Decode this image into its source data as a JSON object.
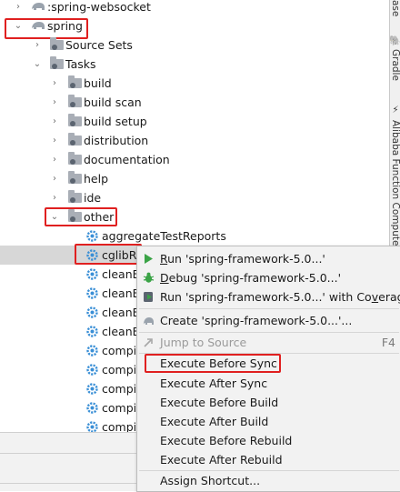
{
  "tree": {
    "rows": [
      {
        "id": "spring-websocket",
        "label": ":spring-websocket",
        "arrow": "›"
      },
      {
        "id": "spring",
        "label": "spring",
        "arrow": "⌄"
      },
      {
        "id": "source-sets",
        "label": "Source Sets",
        "arrow": "›"
      },
      {
        "id": "tasks",
        "label": "Tasks",
        "arrow": "⌄"
      },
      {
        "id": "build",
        "label": "build",
        "arrow": "›"
      },
      {
        "id": "build-scan",
        "label": "build scan",
        "arrow": "›"
      },
      {
        "id": "build-setup",
        "label": "build setup",
        "arrow": "›"
      },
      {
        "id": "distribution",
        "label": "distribution",
        "arrow": "›"
      },
      {
        "id": "documentation",
        "label": "documentation",
        "arrow": "›"
      },
      {
        "id": "help",
        "label": "help",
        "arrow": "›"
      },
      {
        "id": "ide",
        "label": "ide",
        "arrow": "›"
      },
      {
        "id": "other",
        "label": "other",
        "arrow": "⌄"
      },
      {
        "id": "aggregate-test-reports",
        "label": "aggregateTestReports"
      },
      {
        "id": "cglib",
        "label": "cglibRe"
      },
      {
        "id": "clean1",
        "label": "cleanE"
      },
      {
        "id": "clean2",
        "label": "cleanE"
      },
      {
        "id": "clean3",
        "label": "cleanE"
      },
      {
        "id": "clean4",
        "label": "cleanE"
      },
      {
        "id": "compile1",
        "label": "compil"
      },
      {
        "id": "compile2",
        "label": "compil"
      },
      {
        "id": "compile3",
        "label": "compil"
      },
      {
        "id": "compile4",
        "label": "compil"
      },
      {
        "id": "compile5",
        "label": "compil"
      }
    ]
  },
  "side_panel": {
    "top_text": "ase",
    "gradle": "Gradle",
    "alibaba": "Alibaba Function Compute"
  },
  "context_menu": {
    "run": {
      "mnemonic": "R",
      "rest": "un 'spring-framework-5.0...'"
    },
    "debug": {
      "mnemonic": "D",
      "rest": "ebug 'spring-framework-5.0...'"
    },
    "coverage": {
      "text": "Run 'spring-framework-5.0...' with Co",
      "mnemonic": "v",
      "rest": "erage"
    },
    "create": {
      "text": "Create 'spring-framework-5.0...'..."
    },
    "jump": {
      "mnemonic": "J",
      "rest": "ump to Source",
      "shortcut": "F4"
    },
    "execute_before_sync": "Execute Before Sync",
    "execute_after_sync": "Execute After Sync",
    "execute_before_build": "Execute Before Build",
    "execute_after_build": "Execute After Build",
    "execute_before_rebuild": "Execute Before Rebuild",
    "execute_after_rebuild": "Execute After Rebuild",
    "assign_shortcut": "Assign Shortcut..."
  },
  "colors": {
    "highlight_box": "#e02020",
    "run_icon": "#3aa346",
    "debug_icon": "#3aa346",
    "gear_icon": "#3a8fd6"
  }
}
